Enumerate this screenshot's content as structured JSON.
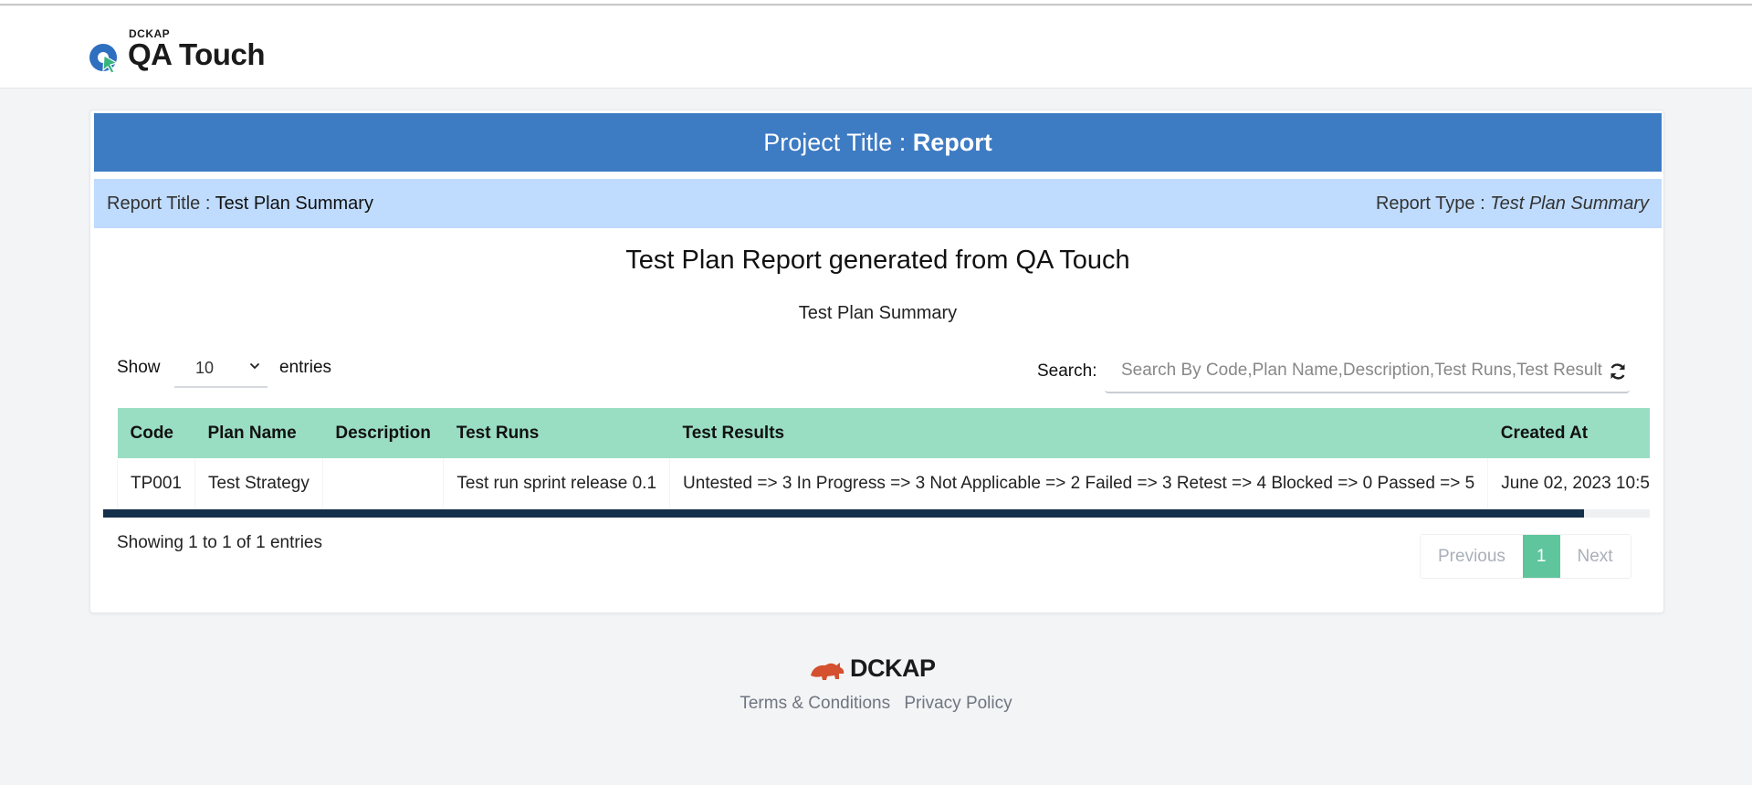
{
  "header": {
    "brand_small": "DCKAP",
    "brand_name": "QA Touch"
  },
  "project": {
    "label": "Project Title : ",
    "value": "Report"
  },
  "report": {
    "title_label": "Report Title : ",
    "title_value": "Test Plan Summary",
    "type_label": "Report Type : ",
    "type_value": "Test Plan Summary"
  },
  "main_title": "Test Plan Report generated from QA Touch",
  "sub_title": "Test Plan Summary",
  "controls": {
    "show_label": "Show",
    "show_value": "10",
    "entries_label": "entries",
    "search_label": "Search:",
    "search_placeholder": "Search By Code,Plan Name,Description,Test Runs,Test Result"
  },
  "table": {
    "headers": [
      "Code",
      "Plan Name",
      "Description",
      "Test Runs",
      "Test Results",
      "Created At"
    ],
    "rows": [
      [
        "TP001",
        "Test Strategy",
        "",
        "Test run sprint release 0.1",
        "Untested => 3 In Progress => 3 Not Applicable => 2 Failed => 3 Retest => 4 Blocked => 0 Passed => 5",
        "June 02, 2023 10:5"
      ]
    ]
  },
  "showing_text": "Showing 1 to 1 of 1 entries",
  "pagination": {
    "previous": "Previous",
    "page": "1",
    "next": "Next"
  },
  "footer": {
    "brand": "DCKAP",
    "terms": "Terms & Conditions",
    "privacy": "Privacy Policy"
  },
  "colors": {
    "project_bar": "#3d7bc3",
    "report_bar": "#bfdbfd",
    "table_header": "#99ddc3",
    "page_active": "#5ec59c"
  }
}
